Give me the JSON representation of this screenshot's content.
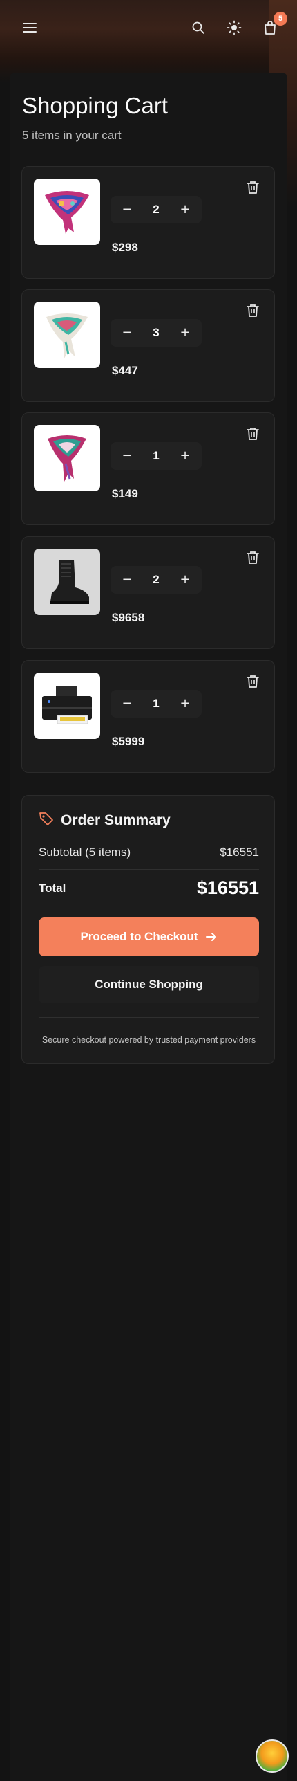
{
  "header": {
    "menu_icon": "hamburger-menu-icon",
    "search_icon": "search-icon",
    "theme_icon": "sun-icon",
    "cart_icon": "shopping-bag-icon",
    "cart_count": "5"
  },
  "page": {
    "title": "Shopping Cart",
    "subtitle": "5 items in your cart"
  },
  "items": [
    {
      "image": "scarf-pink-blue",
      "quantity": "2",
      "price": "$298"
    },
    {
      "image": "scarf-white-teal",
      "quantity": "3",
      "price": "$447"
    },
    {
      "image": "scarf-pink-teal",
      "quantity": "1",
      "price": "$149"
    },
    {
      "image": "black-leather-boot",
      "quantity": "2",
      "price": "$9658"
    },
    {
      "image": "inkjet-printer",
      "quantity": "1",
      "price": "$5999"
    }
  ],
  "summary": {
    "icon": "tag-icon",
    "title": "Order Summary",
    "subtotal_label": "Subtotal (5 items)",
    "subtotal_value": "$16551",
    "total_label": "Total",
    "total_value": "$16551",
    "checkout_label": "Proceed to Checkout",
    "continue_label": "Continue Shopping",
    "secure_note": "Secure checkout powered by trusted payment providers"
  },
  "colors": {
    "accent": "#f4805b",
    "background": "#131313",
    "card": "#1c1c1c"
  }
}
